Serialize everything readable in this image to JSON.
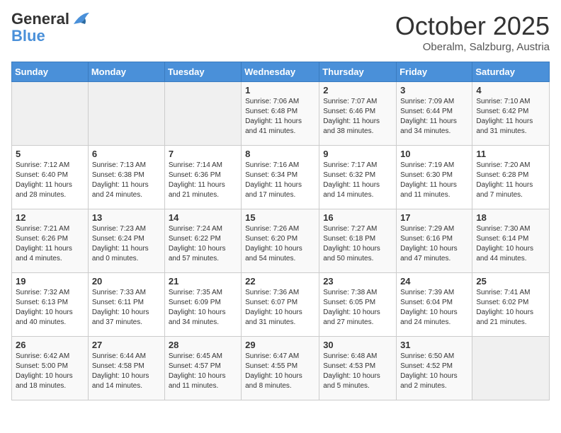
{
  "header": {
    "logo_general": "General",
    "logo_blue": "Blue",
    "month": "October 2025",
    "location": "Oberalm, Salzburg, Austria"
  },
  "days_of_week": [
    "Sunday",
    "Monday",
    "Tuesday",
    "Wednesday",
    "Thursday",
    "Friday",
    "Saturday"
  ],
  "weeks": [
    [
      {
        "day": "",
        "info": ""
      },
      {
        "day": "",
        "info": ""
      },
      {
        "day": "",
        "info": ""
      },
      {
        "day": "1",
        "info": "Sunrise: 7:06 AM\nSunset: 6:48 PM\nDaylight: 11 hours and 41 minutes."
      },
      {
        "day": "2",
        "info": "Sunrise: 7:07 AM\nSunset: 6:46 PM\nDaylight: 11 hours and 38 minutes."
      },
      {
        "day": "3",
        "info": "Sunrise: 7:09 AM\nSunset: 6:44 PM\nDaylight: 11 hours and 34 minutes."
      },
      {
        "day": "4",
        "info": "Sunrise: 7:10 AM\nSunset: 6:42 PM\nDaylight: 11 hours and 31 minutes."
      }
    ],
    [
      {
        "day": "5",
        "info": "Sunrise: 7:12 AM\nSunset: 6:40 PM\nDaylight: 11 hours and 28 minutes."
      },
      {
        "day": "6",
        "info": "Sunrise: 7:13 AM\nSunset: 6:38 PM\nDaylight: 11 hours and 24 minutes."
      },
      {
        "day": "7",
        "info": "Sunrise: 7:14 AM\nSunset: 6:36 PM\nDaylight: 11 hours and 21 minutes."
      },
      {
        "day": "8",
        "info": "Sunrise: 7:16 AM\nSunset: 6:34 PM\nDaylight: 11 hours and 17 minutes."
      },
      {
        "day": "9",
        "info": "Sunrise: 7:17 AM\nSunset: 6:32 PM\nDaylight: 11 hours and 14 minutes."
      },
      {
        "day": "10",
        "info": "Sunrise: 7:19 AM\nSunset: 6:30 PM\nDaylight: 11 hours and 11 minutes."
      },
      {
        "day": "11",
        "info": "Sunrise: 7:20 AM\nSunset: 6:28 PM\nDaylight: 11 hours and 7 minutes."
      }
    ],
    [
      {
        "day": "12",
        "info": "Sunrise: 7:21 AM\nSunset: 6:26 PM\nDaylight: 11 hours and 4 minutes."
      },
      {
        "day": "13",
        "info": "Sunrise: 7:23 AM\nSunset: 6:24 PM\nDaylight: 11 hours and 0 minutes."
      },
      {
        "day": "14",
        "info": "Sunrise: 7:24 AM\nSunset: 6:22 PM\nDaylight: 10 hours and 57 minutes."
      },
      {
        "day": "15",
        "info": "Sunrise: 7:26 AM\nSunset: 6:20 PM\nDaylight: 10 hours and 54 minutes."
      },
      {
        "day": "16",
        "info": "Sunrise: 7:27 AM\nSunset: 6:18 PM\nDaylight: 10 hours and 50 minutes."
      },
      {
        "day": "17",
        "info": "Sunrise: 7:29 AM\nSunset: 6:16 PM\nDaylight: 10 hours and 47 minutes."
      },
      {
        "day": "18",
        "info": "Sunrise: 7:30 AM\nSunset: 6:14 PM\nDaylight: 10 hours and 44 minutes."
      }
    ],
    [
      {
        "day": "19",
        "info": "Sunrise: 7:32 AM\nSunset: 6:13 PM\nDaylight: 10 hours and 40 minutes."
      },
      {
        "day": "20",
        "info": "Sunrise: 7:33 AM\nSunset: 6:11 PM\nDaylight: 10 hours and 37 minutes."
      },
      {
        "day": "21",
        "info": "Sunrise: 7:35 AM\nSunset: 6:09 PM\nDaylight: 10 hours and 34 minutes."
      },
      {
        "day": "22",
        "info": "Sunrise: 7:36 AM\nSunset: 6:07 PM\nDaylight: 10 hours and 31 minutes."
      },
      {
        "day": "23",
        "info": "Sunrise: 7:38 AM\nSunset: 6:05 PM\nDaylight: 10 hours and 27 minutes."
      },
      {
        "day": "24",
        "info": "Sunrise: 7:39 AM\nSunset: 6:04 PM\nDaylight: 10 hours and 24 minutes."
      },
      {
        "day": "25",
        "info": "Sunrise: 7:41 AM\nSunset: 6:02 PM\nDaylight: 10 hours and 21 minutes."
      }
    ],
    [
      {
        "day": "26",
        "info": "Sunrise: 6:42 AM\nSunset: 5:00 PM\nDaylight: 10 hours and 18 minutes."
      },
      {
        "day": "27",
        "info": "Sunrise: 6:44 AM\nSunset: 4:58 PM\nDaylight: 10 hours and 14 minutes."
      },
      {
        "day": "28",
        "info": "Sunrise: 6:45 AM\nSunset: 4:57 PM\nDaylight: 10 hours and 11 minutes."
      },
      {
        "day": "29",
        "info": "Sunrise: 6:47 AM\nSunset: 4:55 PM\nDaylight: 10 hours and 8 minutes."
      },
      {
        "day": "30",
        "info": "Sunrise: 6:48 AM\nSunset: 4:53 PM\nDaylight: 10 hours and 5 minutes."
      },
      {
        "day": "31",
        "info": "Sunrise: 6:50 AM\nSunset: 4:52 PM\nDaylight: 10 hours and 2 minutes."
      },
      {
        "day": "",
        "info": ""
      }
    ]
  ]
}
